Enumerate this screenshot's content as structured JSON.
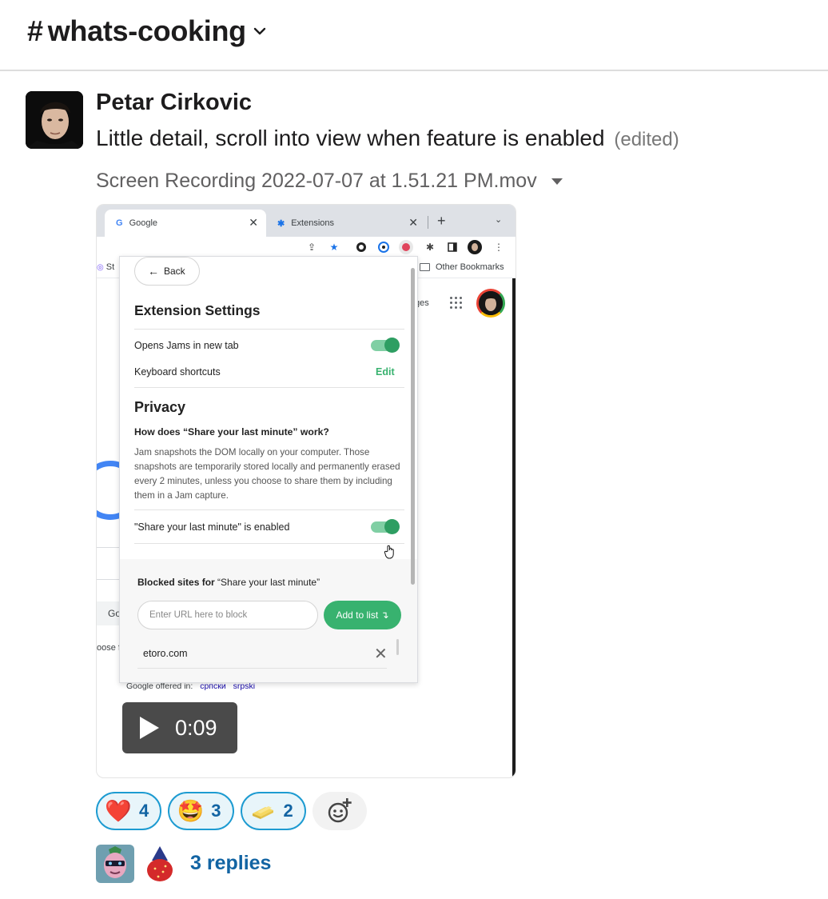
{
  "channel": {
    "hash": "#",
    "name": "whats-cooking"
  },
  "message": {
    "author": "Petar Cirkovic",
    "text": "Little detail, scroll into view when feature is enabled",
    "edited": "(edited)",
    "file_name": "Screen Recording 2022-07-07 at 1.51.21 PM.mov"
  },
  "video": {
    "duration": "0:09",
    "browser": {
      "tabs": [
        {
          "icon": "G",
          "label": "Google"
        },
        {
          "icon": "✱",
          "label": "Extensions"
        }
      ],
      "bookmark_left": "St",
      "bookmark_right": "Other Bookmarks"
    },
    "page_behind": {
      "ges_text": "ges",
      "gc_text": "Go",
      "oose_text": "oose f",
      "offered_label": "Google offered in:",
      "languages": [
        "српски",
        "srpski"
      ]
    },
    "popup": {
      "back_label": "Back",
      "settings_title": "Extension Settings",
      "opens_new_tab_label": "Opens Jams in new tab",
      "opens_new_tab_on": true,
      "keyboard_shortcuts_label": "Keyboard shortcuts",
      "edit_label": "Edit",
      "privacy_title": "Privacy",
      "question": "How does “Share your last minute” work?",
      "description": "Jam snapshots the DOM locally on your computer. Those snapshots are temporarily stored locally and permanently erased every 2 minutes, unless you choose to share them by including them in a Jam capture.",
      "share_enabled_label": "\"Share your last minute\" is enabled",
      "share_enabled_on": true,
      "blocked_bold": "Blocked sites for",
      "blocked_rest": "“Share your last minute”",
      "url_placeholder": "Enter URL here to block",
      "add_button": "Add to list ↴",
      "blocked_items": [
        "etoro.com"
      ],
      "accent_color": "#38b26f"
    }
  },
  "reactions": [
    {
      "emoji": "❤️",
      "icon": "heart",
      "count": "4"
    },
    {
      "emoji": "🤩",
      "icon": "star-struck",
      "count": "3"
    },
    {
      "emoji": "",
      "icon": "butter",
      "count": "2"
    }
  ],
  "thread": {
    "replies_label": "3 replies"
  },
  "colors": {
    "link": "#1264a3",
    "reaction_border": "#1d9bd1"
  }
}
